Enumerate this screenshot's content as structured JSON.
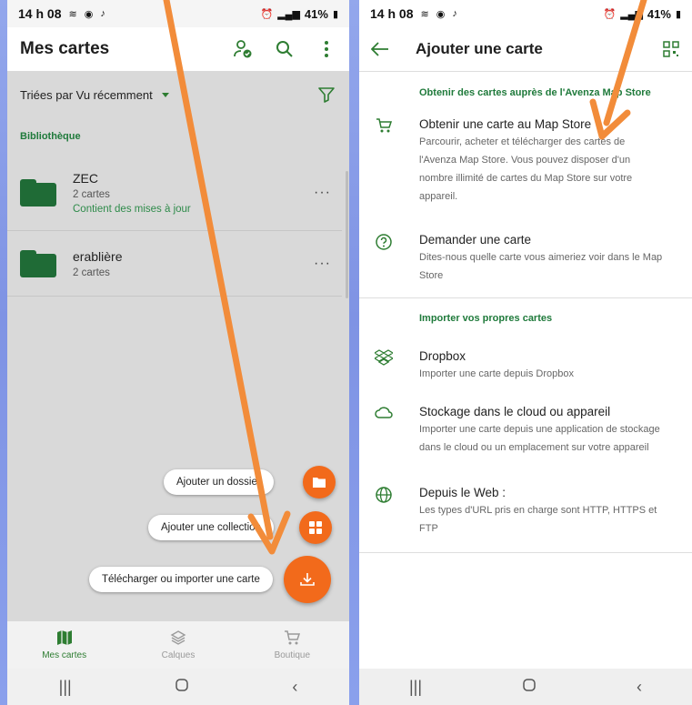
{
  "left": {
    "status": {
      "time": "14 h 08",
      "battery": "41%"
    },
    "appbar": {
      "title": "Mes cartes"
    },
    "sort": {
      "label": "Triées par Vu récemment"
    },
    "section": "Bibliothèque",
    "items": [
      {
        "name": "ZEC",
        "count": "2 cartes",
        "update": "Contient des mises à jour"
      },
      {
        "name": "erablière",
        "count": "2 cartes"
      }
    ],
    "fab": {
      "folder": "Ajouter un dossier",
      "collection": "Ajouter une collection",
      "download": "Télécharger ou importer une carte"
    },
    "nav": {
      "maps": "Mes cartes",
      "layers": "Calques",
      "shop": "Boutique"
    }
  },
  "right": {
    "status": {
      "time": "14 h 08",
      "battery": "41%"
    },
    "appbar": {
      "title": "Ajouter une carte"
    },
    "section1": "Obtenir des cartes auprès de l'Avenza Map Store",
    "items1": [
      {
        "title": "Obtenir une carte au Map Store",
        "desc": [
          "Parcourir, acheter et télécharger des cartes de",
          "l'Avenza Map Store. Vous pouvez disposer d'un",
          "nombre illimité de cartes du Map Store sur votre",
          "appareil."
        ]
      },
      {
        "title": "Demander une carte",
        "desc": [
          "Dites-nous quelle carte vous aimeriez voir dans le Map",
          "Store"
        ]
      }
    ],
    "section2": "Importer vos propres cartes",
    "items2": [
      {
        "title": "Dropbox",
        "desc": [
          "Importer une carte depuis Dropbox"
        ]
      },
      {
        "title": "Stockage dans le cloud ou appareil",
        "desc": [
          "Importer une carte depuis une application de stockage",
          "dans le cloud ou un emplacement sur votre appareil"
        ]
      },
      {
        "title": "Depuis le Web :",
        "desc": [
          "Les types d'URL pris en charge sont HTTP, HTTPS et",
          "FTP"
        ]
      }
    ]
  },
  "colors": {
    "accent": "#f26a1b",
    "green": "#1f7a3b",
    "arrow": "#f28c3a"
  }
}
